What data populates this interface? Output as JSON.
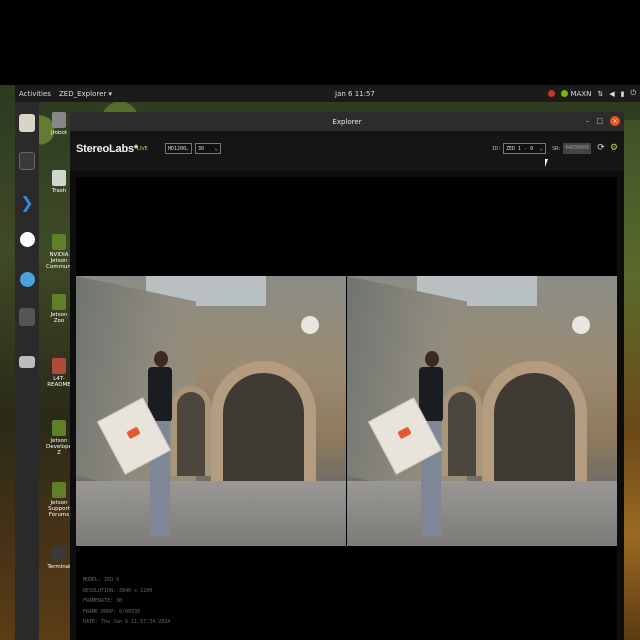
{
  "topbar": {
    "activities": "Activities",
    "app_menu": "ZED_Explorer ▾",
    "clock": "Jan 6 11:57",
    "power_mode": "MAXN"
  },
  "desktop_icons": [
    {
      "label": "jrobot"
    },
    {
      "label": "Trash"
    },
    {
      "label": "NVIDIA Jetson Community"
    },
    {
      "label": "Jetson Zoo"
    },
    {
      "label": "L4T-README"
    },
    {
      "label": "Jetson Developer Z"
    },
    {
      "label": "Jetson Support Forums"
    },
    {
      "label": "Terminal"
    }
  ],
  "window": {
    "title": "Explorer",
    "controls": {
      "minimize": "–",
      "maximize": "□",
      "close": "×"
    }
  },
  "appbar": {
    "brand": "StereoLabs*",
    "live": "LIVE",
    "resolution_select": "HD1200",
    "fps_select": "30",
    "id_label": "ID:",
    "id_value": "ZED 1 - 0",
    "sn_label": "SN:",
    "sn_value": "44030806"
  },
  "info": {
    "model": "MODEL: ZED X",
    "resolution": "RESOLUTION: 3840 x 1200",
    "framerate": "FRAMERATE: 30",
    "frame_drop": "FRAME DROP: 0/00338",
    "date": "DATE: Thu Jan 6 11:57:34 2024"
  },
  "colors": {
    "accent_ubuntu": "#e95420",
    "zed_accent": "#c8d44a"
  }
}
